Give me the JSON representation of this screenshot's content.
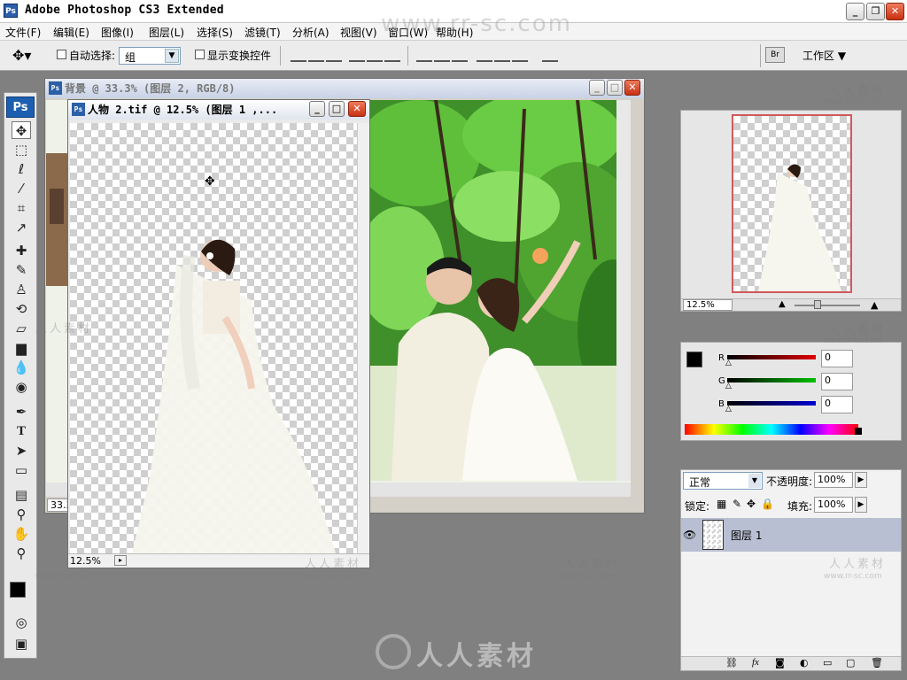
{
  "app": {
    "title": "Adobe Photoshop CS3 Extended",
    "logo": "Ps"
  },
  "menu": [
    "文件(F)",
    "编辑(E)",
    "图像(I)",
    "图层(L)",
    "选择(S)",
    "滤镜(T)",
    "分析(A)",
    "视图(V)",
    "窗口(W)",
    "帮助(H)"
  ],
  "options": {
    "auto_select_label": "自动选择:",
    "auto_select_value": "组",
    "show_transform_label": "显示变换控件",
    "workspace_label": "工作区 ▼"
  },
  "toolbox": {
    "logo": "Ps"
  },
  "doc_back": {
    "title": "背景 @ 33.3% (图层 2, RGB/8)",
    "zoom": "33.3%"
  },
  "doc_front": {
    "title": "人物 2.tif @ 12.5% (图层 1 ,...",
    "zoom": "12.5%"
  },
  "navigator": {
    "zoom": "12.5%"
  },
  "color": {
    "r_label": "R",
    "g_label": "G",
    "b_label": "B",
    "r_value": "0",
    "g_value": "0",
    "b_value": "0"
  },
  "layers": {
    "blend_mode": "正常",
    "opacity_label": "不透明度:",
    "opacity_value": "100%",
    "lock_label": "锁定:",
    "fill_label": "填充:",
    "fill_value": "100%",
    "layer_name": "图层 1"
  },
  "watermark": {
    "site": "www.rr-sc.com",
    "brand": "人人素材"
  },
  "colors": {
    "photoshop_blue": "#1c5fb0",
    "workspace_gray": "#808080",
    "close_red": "#c73112"
  }
}
